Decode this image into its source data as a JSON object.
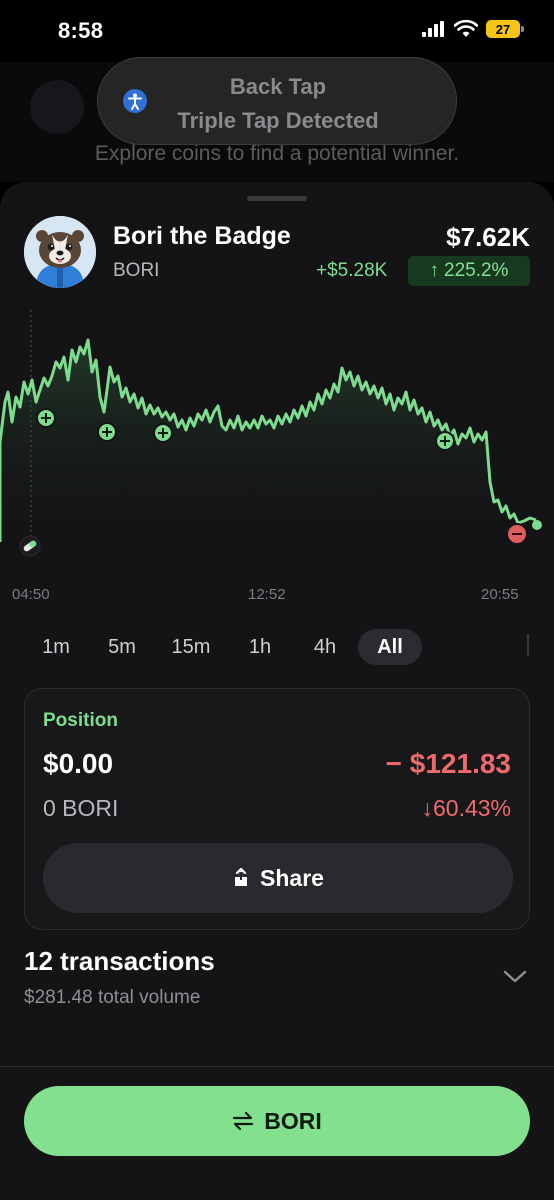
{
  "status_bar": {
    "time": "8:58",
    "battery_level": "27"
  },
  "background": {
    "subtitle": "Explore coins to find a potential winner."
  },
  "toast": {
    "title": "Back Tap",
    "subtitle": "Triple Tap Detected"
  },
  "coin": {
    "name": "Bori the Badge",
    "ticker": "BORI",
    "value": "$7.62K",
    "gain": "+$5.28K",
    "gain_pct": "225.2%",
    "gain_pct_arrow": "↑"
  },
  "chart_data": {
    "type": "line",
    "x_tick_labels": [
      "04:50",
      "12:52",
      "20:55"
    ],
    "y_axis_shown": false,
    "grid": false,
    "line_color": "#7ddc8e",
    "markers": [
      {
        "kind": "buy",
        "color": "#7ddc8e"
      },
      {
        "kind": "buy",
        "color": "#7ddc8e"
      },
      {
        "kind": "buy",
        "color": "#7ddc8e"
      },
      {
        "kind": "buy",
        "color": "#7ddc8e"
      },
      {
        "kind": "sell",
        "color": "#e05d5d"
      }
    ]
  },
  "range_tabs": {
    "items": [
      "1m",
      "5m",
      "15m",
      "1h",
      "4h",
      "All"
    ],
    "selected": "All"
  },
  "position": {
    "label": "Position",
    "value": "$0.00",
    "quantity": "0 BORI",
    "pnl": "− $121.83",
    "pnl_pct": "↓60.43%",
    "share_label": "Share"
  },
  "transactions": {
    "title": "12 transactions",
    "volume": "$281.48 total volume"
  },
  "trade_button": {
    "label": "BORI"
  },
  "colors": {
    "accent": "#7ddc8e",
    "loss": "#ef6b6b",
    "sheet": "#141416"
  }
}
